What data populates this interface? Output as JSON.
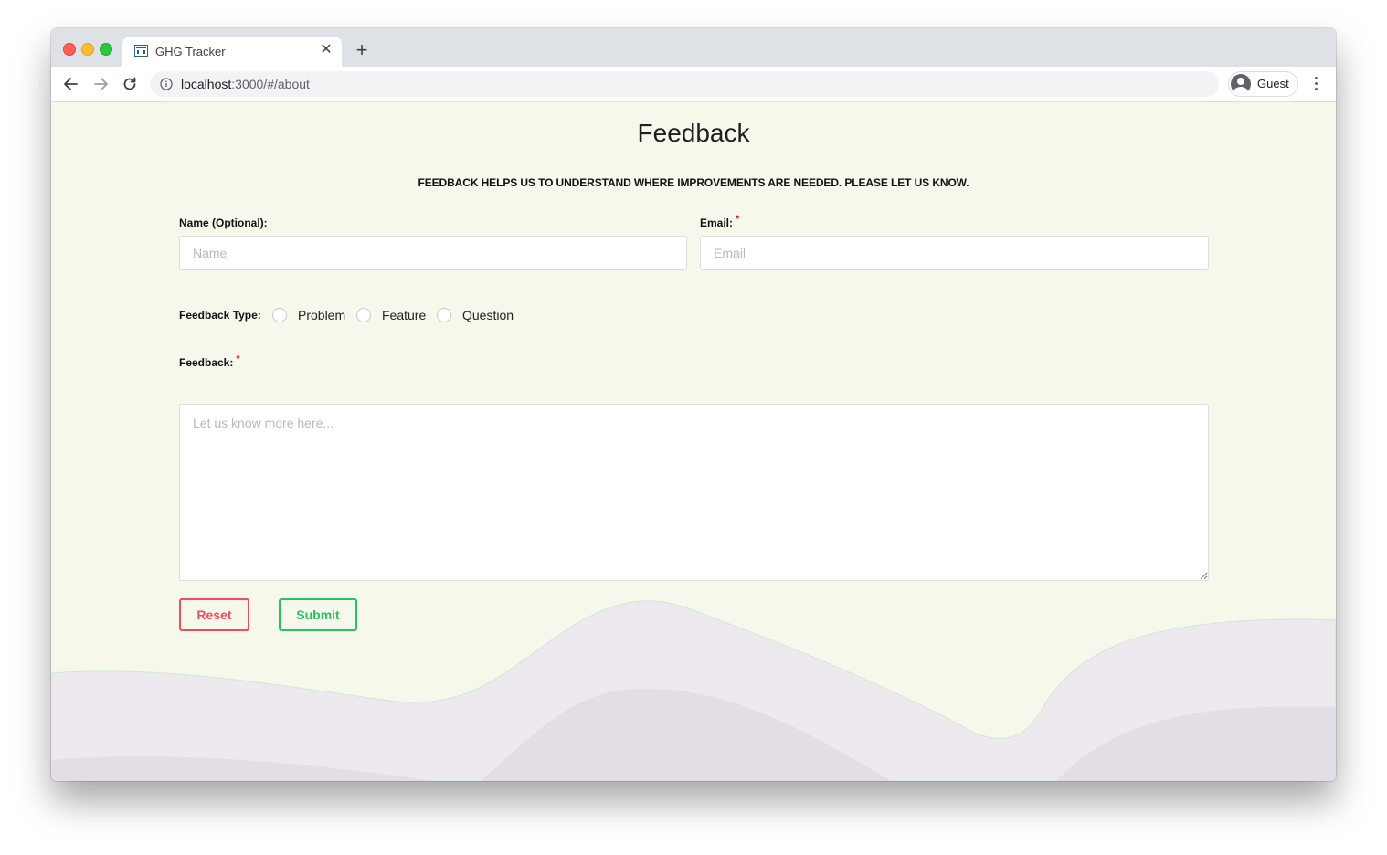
{
  "browser": {
    "tab_title": "GHG Tracker",
    "url_host": "localhost",
    "url_rest": ":3000/#/about",
    "profile_label": "Guest"
  },
  "page": {
    "title": "Feedback",
    "subtitle": "FEEDBACK HELPS US TO UNDERSTAND WHERE IMPROVEMENTS ARE NEEDED. PLEASE LET US KNOW."
  },
  "form": {
    "name_label": "Name (Optional):",
    "name_placeholder": "Name",
    "email_label": "Email:",
    "email_placeholder": "Email",
    "required_marker": "*",
    "feedback_type_label": "Feedback Type:",
    "feedback_types": [
      "Problem",
      "Feature",
      "Question"
    ],
    "feedback_label": "Feedback:",
    "feedback_placeholder": "Let us know more here...",
    "reset_label": "Reset",
    "submit_label": "Submit"
  },
  "colors": {
    "page_background": "#f7f8ec",
    "reset_accent": "#ef4d5a",
    "submit_accent": "#22c55e",
    "required_marker": "#e02020"
  }
}
